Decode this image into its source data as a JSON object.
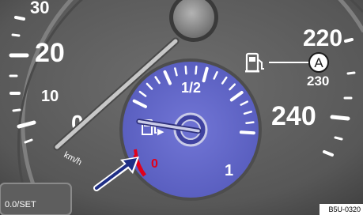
{
  "speedometer": {
    "labels": {
      "v30": "30",
      "v20": "20",
      "v10": "10",
      "v0": "0",
      "v220": "220",
      "v230": "230",
      "v240": "240",
      "unit": "km/h"
    },
    "needle_reading_kmh": 0
  },
  "fuel_gauge": {
    "label_half": "1/2",
    "label_full": "1",
    "fill_level_fraction": 0.0,
    "fuel_door_side_marker": "▶",
    "reserve_color": "#e1001a",
    "dial_color": "#6166c9"
  },
  "callout": {
    "letter": "A"
  },
  "button": {
    "label": "0.0/SET"
  },
  "figure_code": "B5U-0320",
  "icons": [
    "fuel-pump-icon",
    "arrow-pointer-icon"
  ]
}
